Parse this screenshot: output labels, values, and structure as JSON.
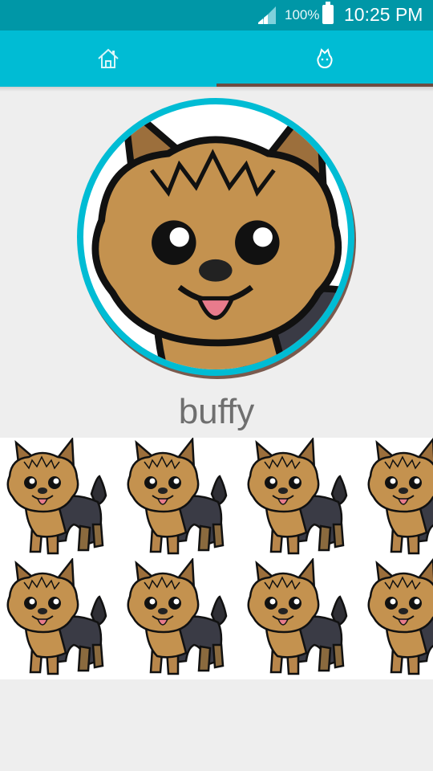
{
  "status_bar": {
    "battery_percent": "100%",
    "time": "10:25 PM",
    "icons": [
      "signal-icon",
      "battery-icon"
    ]
  },
  "tabs": [
    {
      "name": "home",
      "icon": "home-icon",
      "selected": false
    },
    {
      "name": "pet",
      "icon": "pet-icon",
      "selected": true
    }
  ],
  "colors": {
    "status_bar": "#0097a7",
    "tab_bar": "#00bcd4",
    "tab_indicator": "#6d4c41",
    "background": "#eeeeee"
  },
  "profile": {
    "image": "yorkie-puppy-illustration",
    "name": "buffy"
  },
  "gallery": {
    "image": "yorkie-puppy-illustration",
    "visible_count": 8
  }
}
